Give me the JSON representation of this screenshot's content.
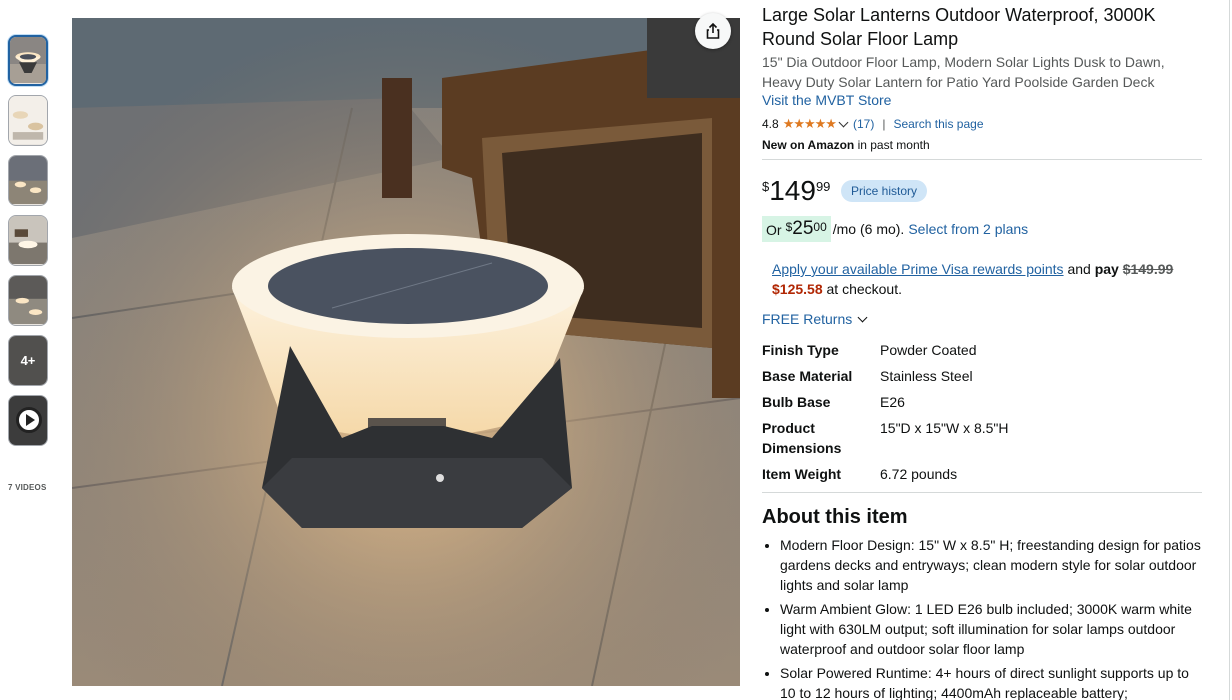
{
  "gallery": {
    "more_label": "4+",
    "videos_label": "7 VIDEOS"
  },
  "product": {
    "title": "Large Solar Lanterns Outdoor Waterproof, 3000K Round Solar Floor Lamp",
    "subtitle": "15\" Dia Outdoor Floor Lamp, Modern Solar Lights Dusk to Dawn, Heavy Duty Solar Lantern for Patio Yard Poolside Garden Deck",
    "store_link": "Visit the MVBT Store",
    "rating_value": "4.8",
    "rating_stars": "★★★★★",
    "rating_count": "(17)",
    "search_page": "Search this page",
    "separator": "|",
    "new_label": "New on Amazon",
    "new_suffix": "in past month"
  },
  "pricing": {
    "currency": "$",
    "whole": "149",
    "fraction": "99",
    "price_history": "Price history",
    "monthly_or": "Or",
    "monthly_currency": "$",
    "monthly_whole": "25",
    "monthly_fraction": "00",
    "monthly_suffix": "/mo (6 mo).",
    "plans_link": "Select from 2 plans",
    "visa_link": "Apply your available Prime Visa rewards points",
    "visa_and": "and",
    "visa_pay": "pay",
    "visa_original": "$149.99",
    "visa_discounted": "$125.58",
    "visa_suffix": "at checkout."
  },
  "returns": {
    "label": "FREE Returns"
  },
  "specs": [
    {
      "key": "Finish Type",
      "value": "Powder Coated"
    },
    {
      "key": "Base Material",
      "value": "Stainless Steel"
    },
    {
      "key": "Bulb Base",
      "value": "E26"
    },
    {
      "key": "Product Dimensions",
      "value": "15\"D x 15\"W x 8.5\"H"
    },
    {
      "key": "Item Weight",
      "value": "6.72 pounds"
    }
  ],
  "about": {
    "title": "About this item",
    "bullets": [
      "Modern Floor Design: 15\" W x 8.5\" H; freestanding design for patios gardens decks and entryways; clean modern style for solar outdoor lights and solar lamp",
      "Warm Ambient Glow: 1 LED E26 bulb included; 3000K warm white light with 630LM output; soft illumination for solar lamps outdoor waterproof and outdoor solar floor lamp",
      "Solar Powered Runtime: 4+ hours of direct sunlight supports up to 10 to 12 hours of lighting; 4400mAh replaceable battery;"
    ]
  }
}
